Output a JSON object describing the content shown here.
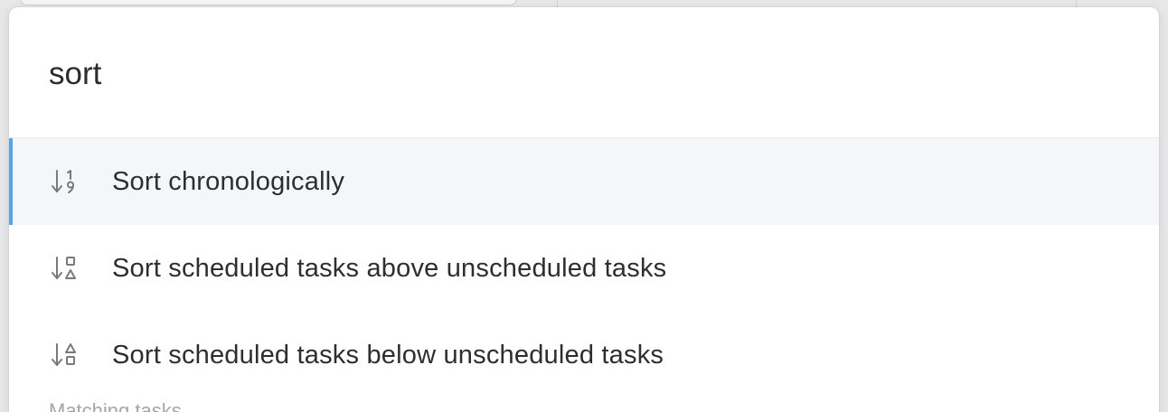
{
  "search": {
    "value": "sort"
  },
  "results": [
    {
      "label": "Sort chronologically",
      "icon": "sort-numeric-icon",
      "selected": true
    },
    {
      "label": "Sort scheduled tasks above unscheduled tasks",
      "icon": "sort-shapes-square-first-icon",
      "selected": false
    },
    {
      "label": "Sort scheduled tasks below unscheduled tasks",
      "icon": "sort-shapes-triangle-first-icon",
      "selected": false
    }
  ],
  "section": {
    "header": "Matching tasks"
  },
  "colors": {
    "accent": "#5aa2ec",
    "selected_bg": "#f5f6f8",
    "text": "#2e2e30",
    "icon": "#7a7a7e"
  }
}
